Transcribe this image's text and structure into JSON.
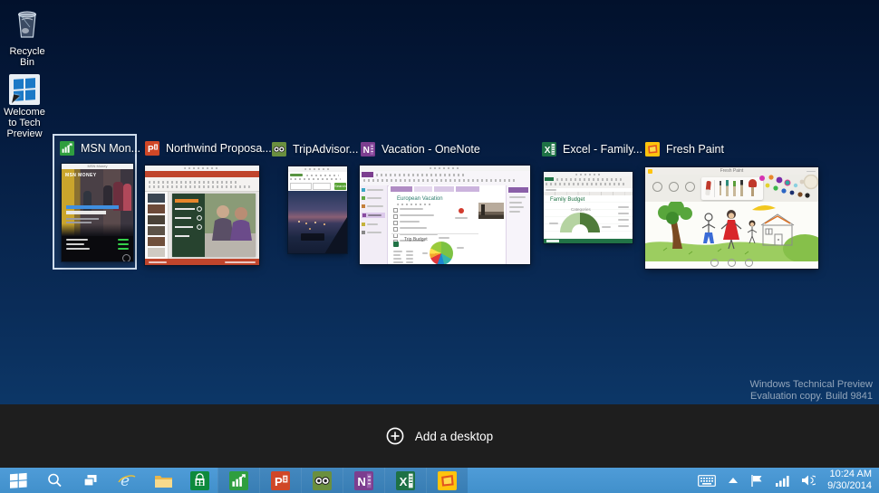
{
  "colors": {
    "desk_top": "#02112c",
    "desk_bottom": "#0e4074",
    "band": "#1e1e1e",
    "taskbar": "#4f9cd8",
    "selection": "#cfdded",
    "excel_green": "#1e7145",
    "onenote_purple": "#7c3e8f",
    "powerpoint_red": "#d04727",
    "msn_green": "#2f9e3f",
    "tripadvisor_green": "#6a8f3f",
    "freshpaint_yellow": "#ffc40d"
  },
  "desktop": {
    "icons": [
      {
        "label": "Recycle Bin"
      },
      {
        "label": "Welcome to Tech Preview"
      }
    ],
    "watermark_line1": "Windows Technical Preview",
    "watermark_line2": "Evaluation copy. Build 9841"
  },
  "task_view": {
    "add_desktop_label": "Add a desktop",
    "windows": [
      {
        "title": "MSN Mon...",
        "app": "MSN Money",
        "selected": true
      },
      {
        "title": "Northwind Proposa...",
        "app": "PowerPoint",
        "selected": false
      },
      {
        "title": "TripAdvisor...",
        "app": "TripAdvisor",
        "selected": false
      },
      {
        "title": "Vacation - OneNote",
        "app": "OneNote",
        "selected": false
      },
      {
        "title": "Excel - Family...",
        "app": "Excel",
        "selected": false
      },
      {
        "title": "Fresh Paint",
        "app": "Fresh Paint",
        "selected": false
      }
    ]
  },
  "thumbnails": {
    "msn": {
      "window_title": "MSN Money",
      "logo": "MSN MONEY"
    },
    "tripadvisor": {
      "search_button": "Search"
    },
    "onenote": {
      "page_title": "European Vacation",
      "budget_title": "Trip Budget"
    },
    "excel": {
      "sheet_title": "Family Budget",
      "chart_label": "Categories"
    },
    "fresh_paint": {
      "window_title": "Fresh Paint"
    }
  },
  "taskbar": {
    "clock_time": "10:24 AM",
    "clock_date": "9/30/2014"
  }
}
